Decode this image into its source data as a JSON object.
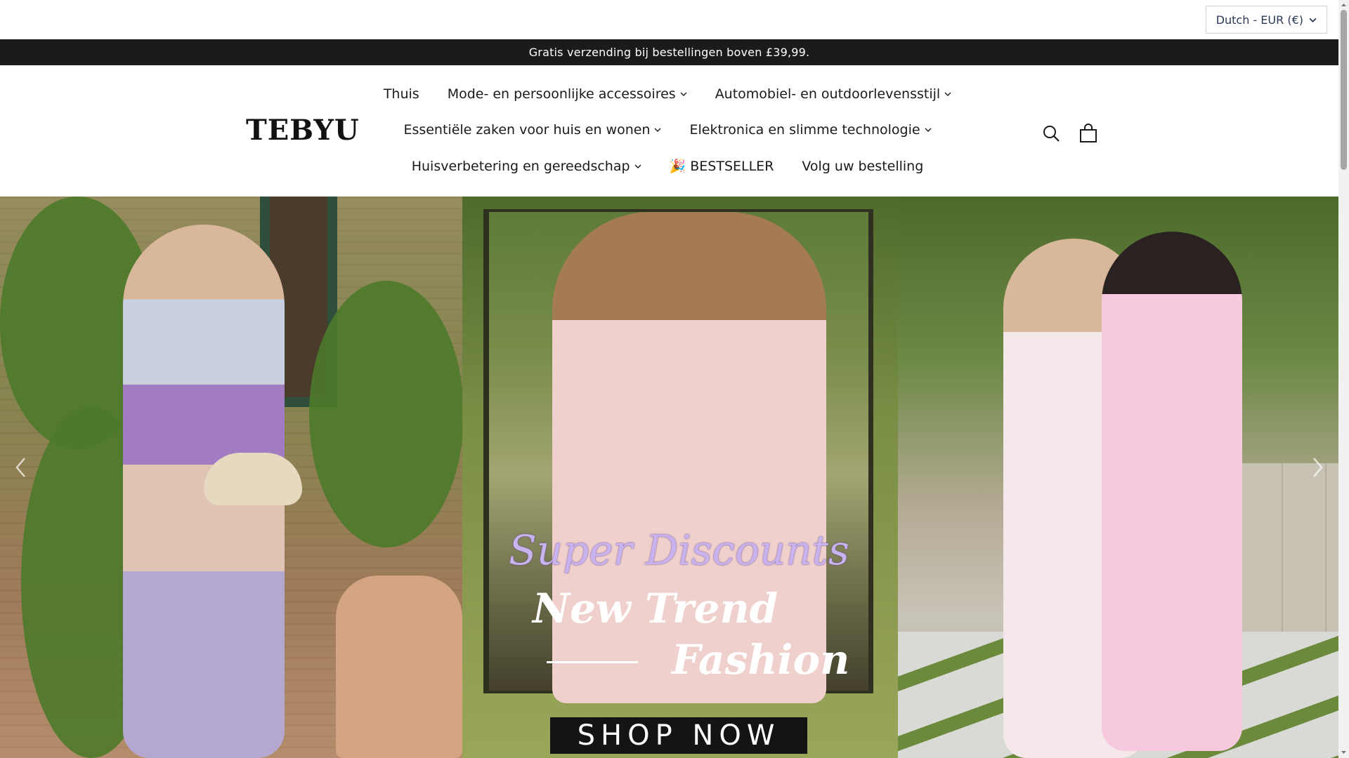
{
  "locale_selector": {
    "label": "Dutch - EUR (€)"
  },
  "announcement": {
    "text": "Gratis verzending bij bestellingen boven £39,99."
  },
  "logo": {
    "text": "TEBYU"
  },
  "nav": {
    "row1": [
      {
        "label": "Thuis",
        "has_dropdown": false
      },
      {
        "label": "Mode- en persoonlijke accessoires",
        "has_dropdown": true
      },
      {
        "label": "Automobiel- en outdoorlevensstijl",
        "has_dropdown": true
      }
    ],
    "row2": [
      {
        "label": "Essentiële zaken voor huis en wonen",
        "has_dropdown": true
      },
      {
        "label": "Elektronica en slimme technologie",
        "has_dropdown": true
      }
    ],
    "row3": [
      {
        "label": "Huisverbetering en gereedschap",
        "has_dropdown": true
      },
      {
        "label": "🎉 BESTSELLER",
        "has_dropdown": false
      },
      {
        "label": "Volg uw bestelling",
        "has_dropdown": false
      }
    ]
  },
  "header_icons": {
    "search": "search-icon",
    "cart": "cart-icon"
  },
  "hero": {
    "promo_script": "Super Discounts",
    "promo_title_line1": "New Trend",
    "promo_title_line2": "Fashion",
    "cta_label": "SHOP NOW",
    "prev_icon": "chevron-left-icon",
    "next_icon": "chevron-right-icon"
  },
  "colors": {
    "announcement_bg": "#1b1b1b",
    "announcement_text": "#ffffff",
    "cta_bg": "#141414",
    "promo_script": "#c9b3ef"
  }
}
